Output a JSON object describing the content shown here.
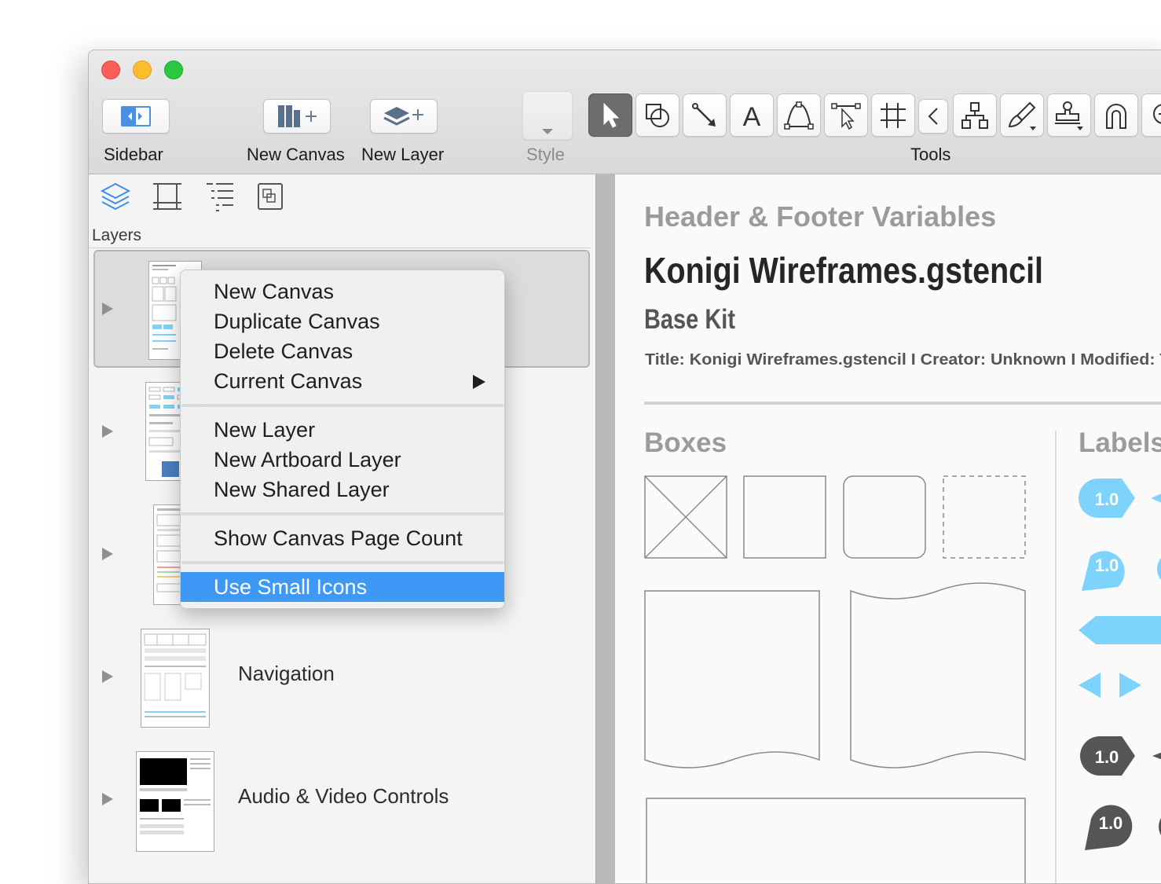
{
  "toolbar": {
    "sidebar_label": "Sidebar",
    "new_canvas_label": "New Canvas",
    "new_layer_label": "New Layer",
    "style_label": "Style",
    "tools_label": "Tools",
    "tool_icons": [
      "selection-icon",
      "shape-icon",
      "line-icon",
      "text-icon",
      "pen-icon",
      "point-editor-icon",
      "table-icon",
      "collapse-icon",
      "diagram-icon",
      "style-brush-icon",
      "stamp-icon",
      "magnet-icon",
      "zoom-icon"
    ]
  },
  "sidebar": {
    "tabs": [
      "layers-tab-icon",
      "canvas-tab-icon",
      "outline-tab-icon",
      "content-tab-icon"
    ],
    "section_title": "Layers",
    "rows": [
      {
        "title": "",
        "selected": true
      },
      {
        "title": "",
        "selected": false
      },
      {
        "title": "",
        "selected": false
      },
      {
        "title": "Navigation",
        "selected": false
      },
      {
        "title": "Audio & Video Controls",
        "selected": false
      }
    ]
  },
  "context_menu": {
    "items": [
      {
        "label": "New Canvas"
      },
      {
        "label": "Duplicate Canvas"
      },
      {
        "label": "Delete Canvas"
      },
      {
        "label": "Current Canvas",
        "submenu": true
      },
      {
        "label": "New Layer"
      },
      {
        "label": "New Artboard Layer"
      },
      {
        "label": "New Shared Layer"
      },
      {
        "label": "Show Canvas Page Count"
      },
      {
        "label": "Use Small Icons",
        "highlighted": true
      }
    ]
  },
  "canvas": {
    "header_title": "Header & Footer Variables",
    "doc_title": "Konigi Wireframes.gstencil",
    "kit_title": "Base Kit",
    "meta_line": "Title: Konigi Wireframes.gstencil  I  Creator: Unknown  I  Modified: Tu",
    "boxes_title": "Boxes",
    "labels_title": "Labels",
    "badge_value": "1.0"
  },
  "colors": {
    "highlight": "#3d99f5",
    "label_blue": "#7dd3fc",
    "label_dark": "#555555",
    "traffic_close": "#fc5f57",
    "traffic_min": "#fdbc2e",
    "traffic_max": "#2ac840"
  }
}
